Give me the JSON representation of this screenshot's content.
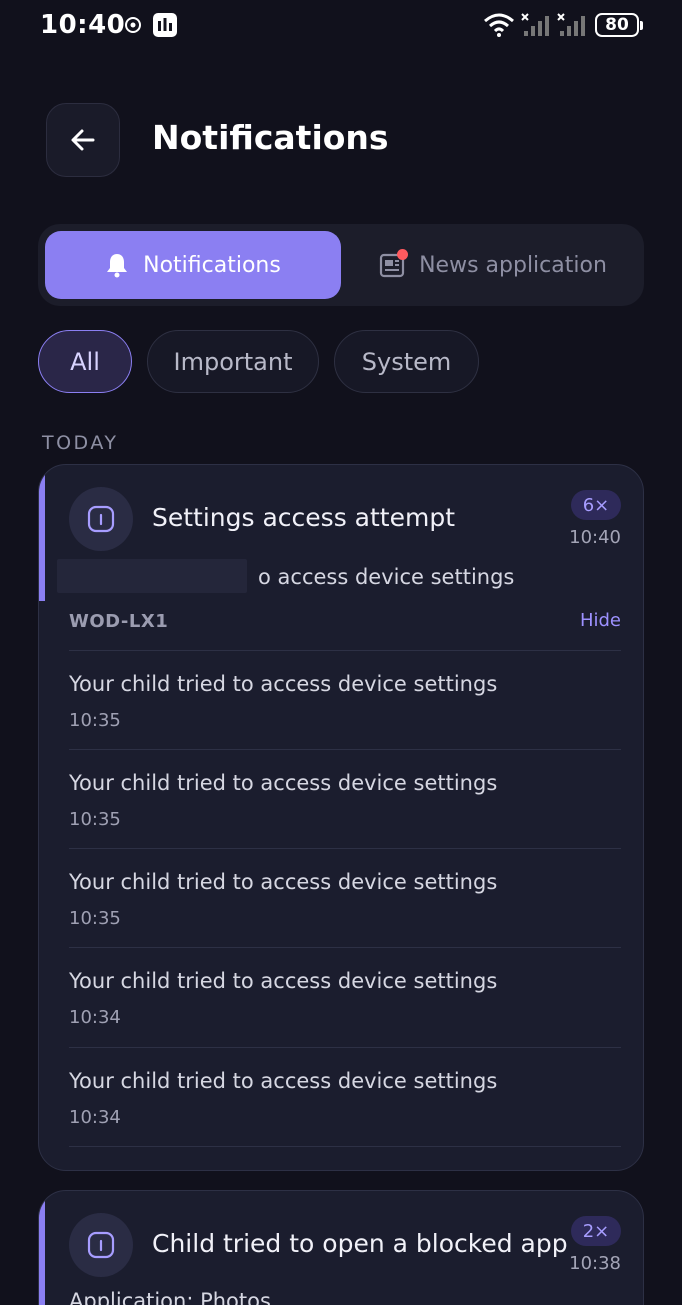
{
  "status_bar": {
    "time": "10:40",
    "battery": "80"
  },
  "header": {
    "title": "Notifications"
  },
  "segments": {
    "active_label": "Notifications",
    "inactive_label": "News application"
  },
  "filters": {
    "all": "All",
    "important": "Important",
    "system": "System"
  },
  "section_label": "TODAY",
  "cards": [
    {
      "title": "Settings access attempt",
      "count": "6×",
      "time": "10:40",
      "message": "Your child tried to access device settings",
      "message_visible": "o access device settings",
      "device": "WOD-LX1",
      "hide_label": "Hide",
      "items": [
        {
          "text": "Your child tried to access device settings",
          "time": "10:35"
        },
        {
          "text": "Your child tried to access device settings",
          "time": "10:35"
        },
        {
          "text": "Your child tried to access device settings",
          "time": "10:35"
        },
        {
          "text": "Your child tried to access device settings",
          "time": "10:34"
        },
        {
          "text": "Your child tried to access device settings",
          "time": "10:34"
        }
      ]
    },
    {
      "title": "Child tried to open a blocked app",
      "count": "2×",
      "time": "10:38",
      "message": "Application: Photos"
    }
  ],
  "colors": {
    "accent": "#8b7ff2",
    "background": "#11111c",
    "card": "#1b1d2e",
    "alert": "#ff5a5f"
  }
}
